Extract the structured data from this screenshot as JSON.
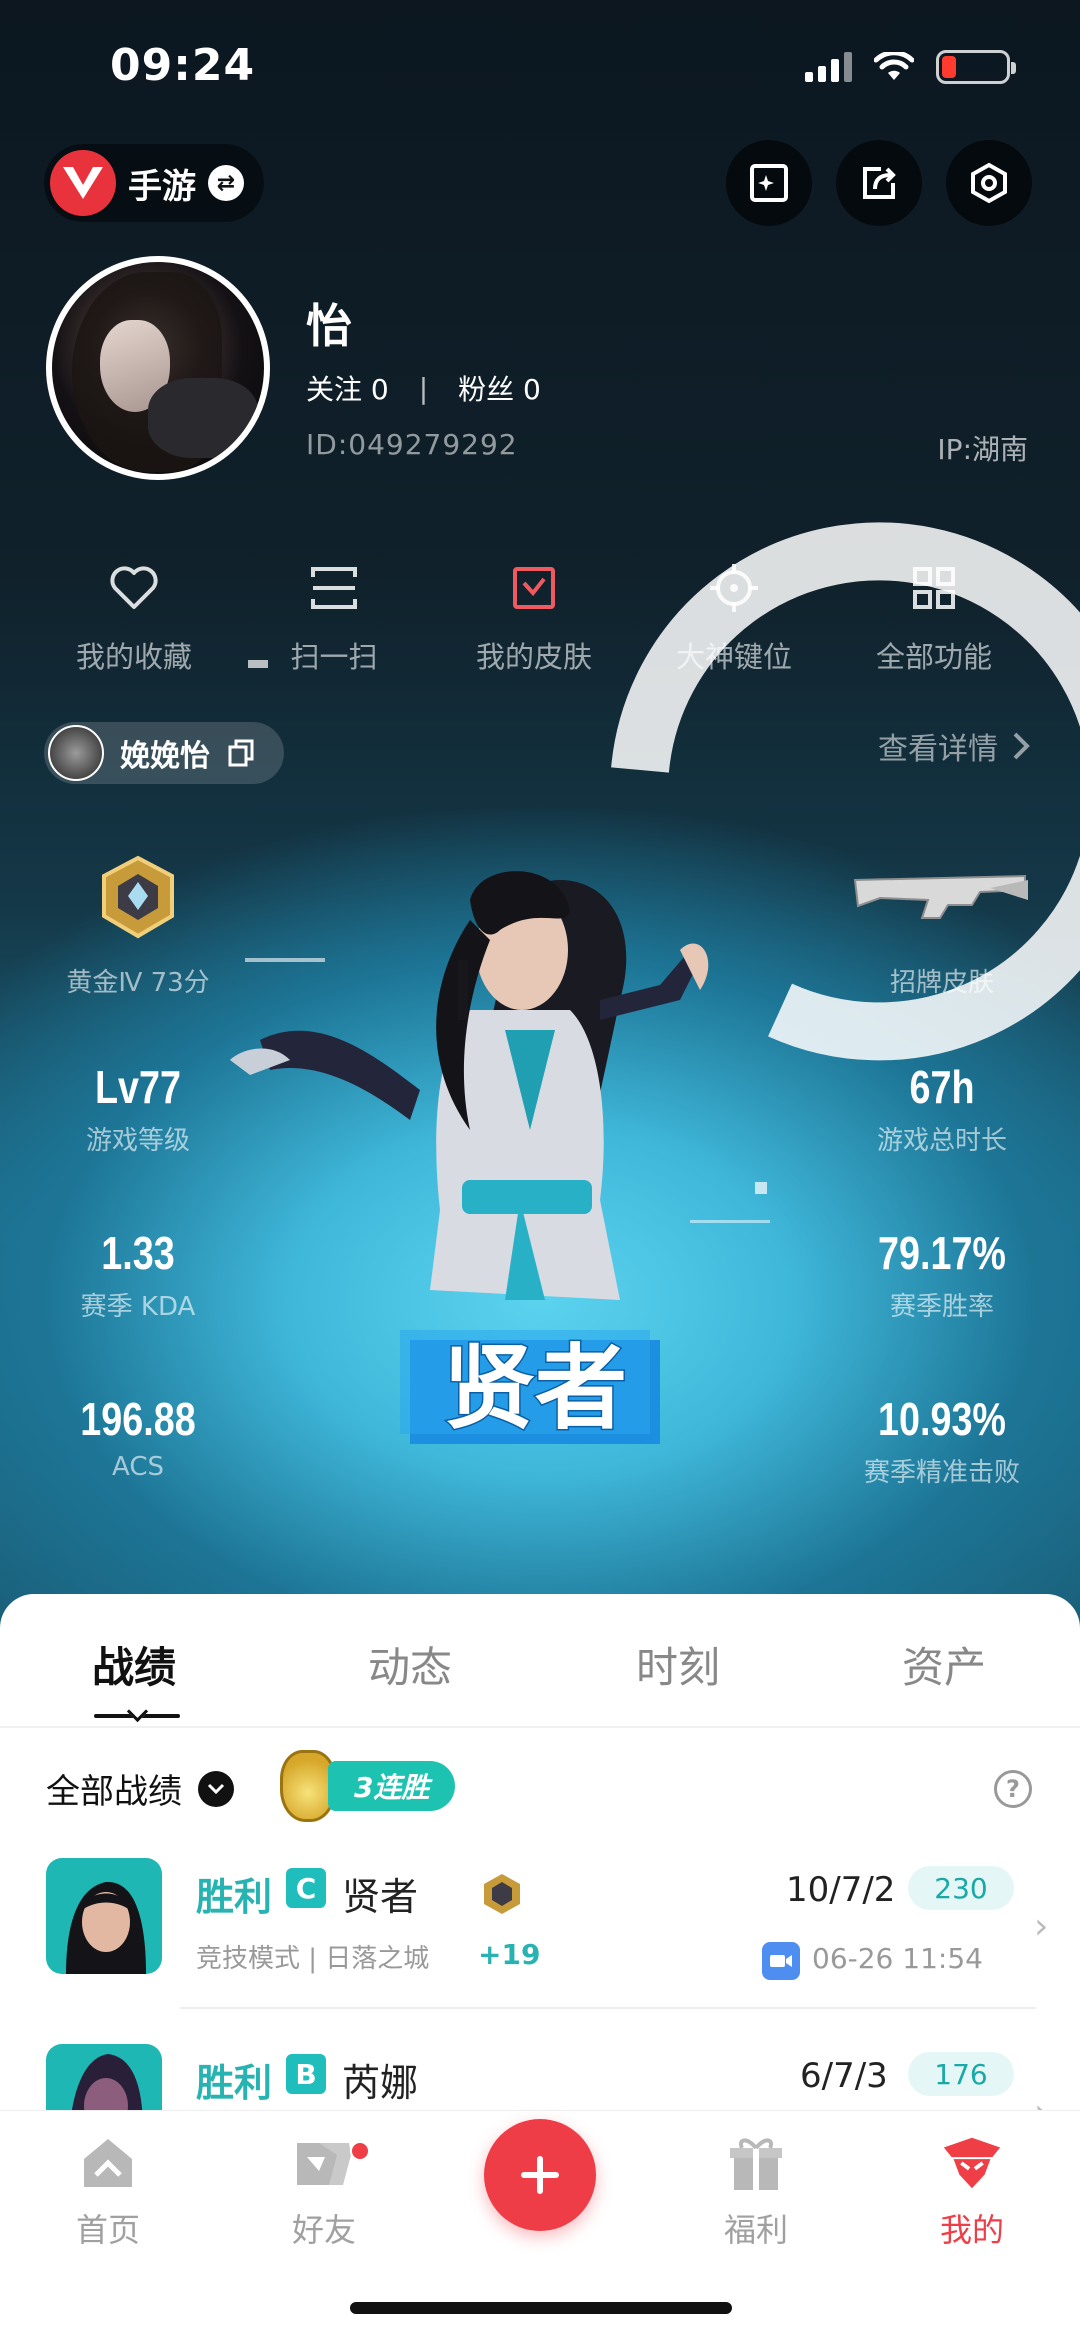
{
  "status": {
    "time": "09:24"
  },
  "header": {
    "game_label": "手游"
  },
  "profile": {
    "name": "怡",
    "following": "关注 0",
    "followers": "粉丝 0",
    "id": "ID:049279292",
    "ip": "IP:湖南"
  },
  "quick_menu": [
    {
      "label": "我的收藏",
      "icon": "heart-icon"
    },
    {
      "label": "扫一扫",
      "icon": "scan-icon"
    },
    {
      "label": "我的皮肤",
      "icon": "skin-icon"
    },
    {
      "label": "大神键位",
      "icon": "crosshair-icon"
    },
    {
      "label": "全部功能",
      "icon": "grid-icon"
    }
  ],
  "character": {
    "name": "娩娩怡",
    "view_detail": "查看详情"
  },
  "agent": {
    "name": "贤者"
  },
  "stats_left": [
    {
      "value": "",
      "caption": "黄金Ⅳ 73分"
    },
    {
      "value": "Lv77",
      "caption": "游戏等级"
    },
    {
      "value": "1.33",
      "caption": "赛季 KDA"
    },
    {
      "value": "196.88",
      "caption": "ACS"
    }
  ],
  "stats_right": [
    {
      "value": "",
      "caption": "招牌皮肤"
    },
    {
      "value": "67h",
      "caption": "游戏总时长"
    },
    {
      "value": "79.17%",
      "caption": "赛季胜率"
    },
    {
      "value": "10.93%",
      "caption": "赛季精准击败"
    }
  ],
  "tabs": [
    "战绩",
    "动态",
    "时刻",
    "资产"
  ],
  "filter": {
    "label": "全部战绩",
    "streak": "3连胜"
  },
  "matches": [
    {
      "result": "胜利",
      "grade": "C",
      "agent": "贤者",
      "mode": "竞技模式 | 日落之城",
      "delta": "+19",
      "kda": "10/7/2",
      "score": "230",
      "time": "06-26 11:54"
    },
    {
      "result": "胜利",
      "grade": "B",
      "agent": "芮娜",
      "mode": "",
      "delta": "",
      "kda": "6/7/3",
      "score": "176",
      "time": ""
    }
  ],
  "nav": [
    {
      "label": "首页",
      "icon": "home-icon"
    },
    {
      "label": "好友",
      "icon": "friends-icon"
    },
    {
      "label": "福利",
      "icon": "gift-icon"
    },
    {
      "label": "我的",
      "icon": "me-icon"
    }
  ],
  "colors": {
    "accent": "#ee3d47",
    "win": "#27b3b1",
    "hero_glow": "#5bd3ef"
  }
}
